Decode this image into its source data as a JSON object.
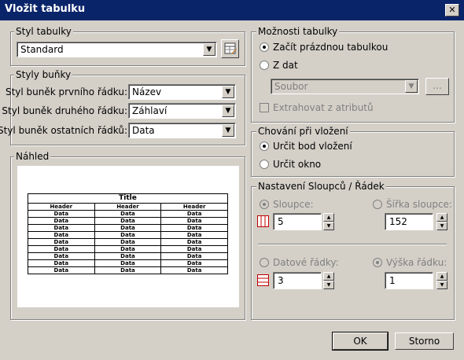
{
  "window": {
    "title": "Vložit tabulku",
    "close_symbol": "✕"
  },
  "table_style": {
    "label": "Styl tabulky",
    "value": "Standard"
  },
  "cell_styles": {
    "label": "Styly buňky",
    "rows": [
      {
        "label": "Styl buněk prvního řádku:",
        "value": "Název"
      },
      {
        "label": "Styl buněk druhého řádku:",
        "value": "Záhlaví"
      },
      {
        "label": "Styl buněk ostatních řádků:",
        "value": "Data"
      }
    ]
  },
  "preview": {
    "label": "Náhled",
    "title": "Title",
    "header": [
      "Header",
      "Header",
      "Header"
    ],
    "data_cell": "Data"
  },
  "table_options": {
    "label": "Možnosti tabulky",
    "empty_table": "Začít prázdnou tabulkou",
    "from_data": "Z dat",
    "source": "Soubor",
    "browse": "...",
    "extract_attributes": "Extrahovat z atributů"
  },
  "insert_behavior": {
    "label": "Chování při vložení",
    "insertion_point": "Určit bod vložení",
    "window": "Určit okno"
  },
  "columns_rows": {
    "label": "Nastavení Sloupců / Řádek",
    "columns_label": "Sloupce:",
    "columns_value": "5",
    "column_width_label": "Šířka sloupce:",
    "column_width_value": "152",
    "data_rows_label": "Datové řádky:",
    "data_rows_value": "3",
    "row_height_label": "Výška řádku:",
    "row_height_value": "1"
  },
  "buttons": {
    "ok": "OK",
    "cancel": "Storno"
  },
  "colors": {
    "titlebar": "#0a246a",
    "icon_red": "#c00000"
  }
}
